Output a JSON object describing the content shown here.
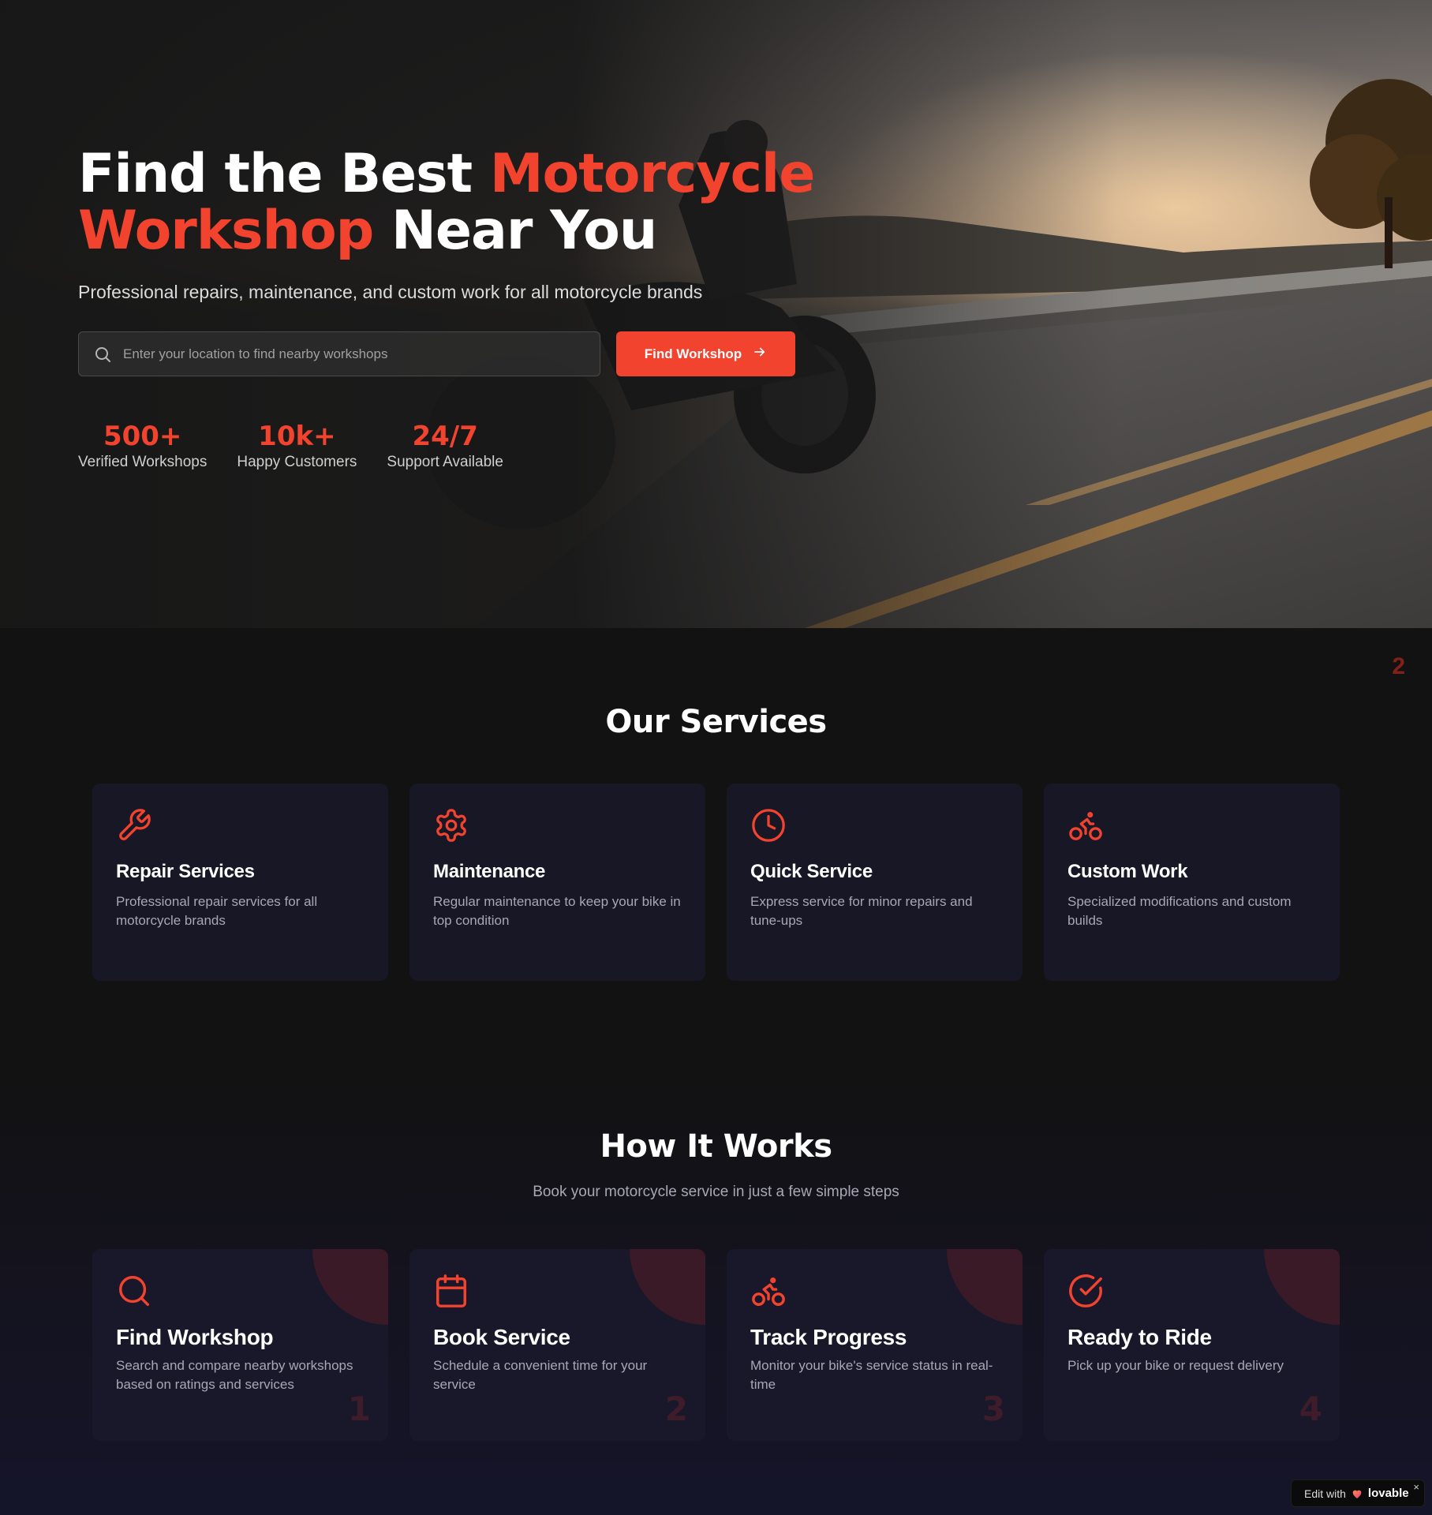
{
  "hero": {
    "title_line1_white": "Find the Best ",
    "title_line1_accent": "Motorcycle",
    "title_line2_accent": "Workshop",
    "title_line2_white": " Near You",
    "subtitle": "Professional repairs, maintenance, and custom work for all motorcycle brands",
    "search": {
      "placeholder": "Enter your location to find nearby workshops",
      "value": "",
      "icon": "search-icon"
    },
    "find_button": {
      "label": "Find Workshop",
      "icon": "arrow-right-icon"
    },
    "stats": [
      {
        "value": "500+",
        "label": "Verified Workshops"
      },
      {
        "value": "10k+",
        "label": "Happy Customers"
      },
      {
        "value": "24/7",
        "label": "Support Available"
      }
    ]
  },
  "corner_mark": "2",
  "services": {
    "title": "Our Services",
    "items": [
      {
        "icon": "wrench-icon",
        "title": "Repair Services",
        "description": "Professional repair services for all motorcycle brands"
      },
      {
        "icon": "gear-icon",
        "title": "Maintenance",
        "description": "Regular maintenance to keep your bike in top condition"
      },
      {
        "icon": "clock-icon",
        "title": "Quick Service",
        "description": "Express service for minor repairs and tune-ups"
      },
      {
        "icon": "bike-icon",
        "title": "Custom Work",
        "description": "Specialized modifications and custom builds"
      }
    ]
  },
  "how_it_works": {
    "title": "How It Works",
    "subtitle": "Book your motorcycle service in just a few simple steps",
    "steps": [
      {
        "number": "1",
        "icon": "search-icon",
        "title": "Find Workshop",
        "description": "Search and compare nearby workshops based on ratings and services"
      },
      {
        "number": "2",
        "icon": "calendar-icon",
        "title": "Book Service",
        "description": "Schedule a convenient time for your service"
      },
      {
        "number": "3",
        "icon": "bike-icon",
        "title": "Track Progress",
        "description": "Monitor your bike's service status in real-time"
      },
      {
        "number": "4",
        "icon": "check-circle-icon",
        "title": "Ready to Ride",
        "description": "Pick up your bike or request delivery"
      }
    ]
  },
  "badge": {
    "prefix": "Edit with",
    "brand": "lovable",
    "close": "×"
  },
  "colors": {
    "accent": "#f2432f",
    "background": "#121212",
    "card": "#171725",
    "muted_text": "#a8a8b4"
  }
}
